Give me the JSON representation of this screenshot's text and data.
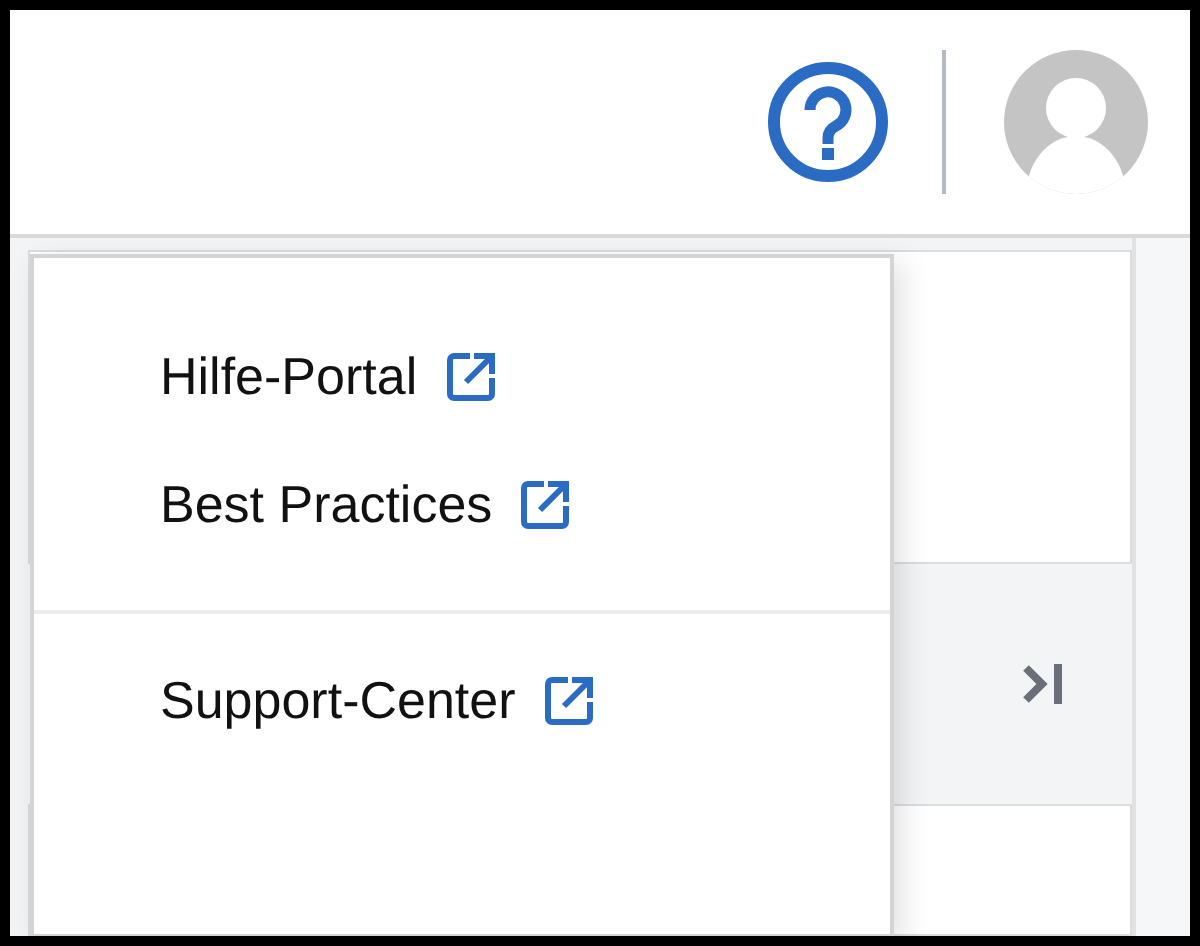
{
  "help_menu": {
    "groups": [
      {
        "items": [
          {
            "label": "Hilfe-Portal",
            "external": true
          },
          {
            "label": "Best Practices",
            "external": true
          }
        ]
      },
      {
        "items": [
          {
            "label": "Support-Center",
            "external": true
          }
        ]
      }
    ]
  }
}
